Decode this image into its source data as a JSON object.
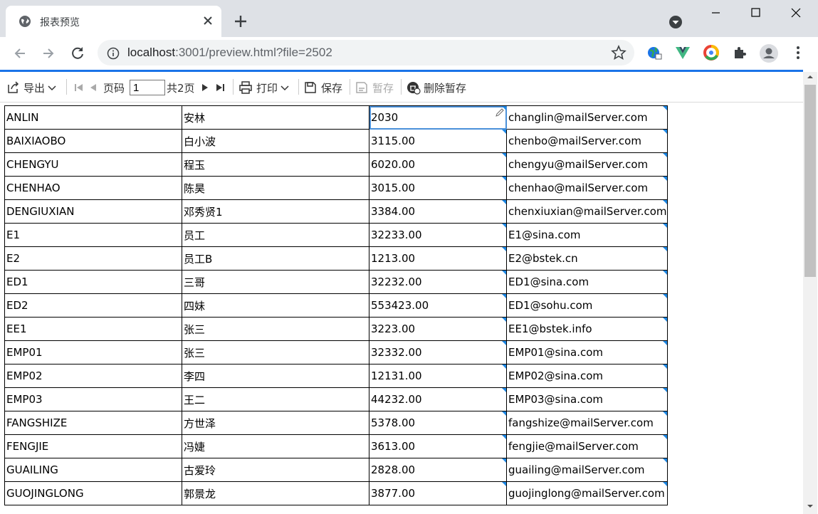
{
  "browser": {
    "tab_title": "报表预览",
    "url_host": "localhost",
    "url_rest": ":3001/preview.html?file=2502"
  },
  "toolbar": {
    "export": "导出",
    "page_label": "页码",
    "page_value": "1",
    "page_total": "共2页",
    "print": "打印",
    "save": "保存",
    "temp_save": "暂存",
    "delete_temp": "删除暂存"
  },
  "table": {
    "rows": [
      [
        "ANLIN",
        "安林",
        "2030",
        "changlin@mailServer.com"
      ],
      [
        "BAIXIAOBO",
        "白小波",
        "3115.00",
        "chenbo@mailServer.com"
      ],
      [
        "CHENGYU",
        "程玉",
        "6020.00",
        "chengyu@mailServer.com"
      ],
      [
        "CHENHAO",
        "陈昊",
        "3015.00",
        "chenhao@mailServer.com"
      ],
      [
        "DENGIUXIAN",
        "邓秀贤1",
        "3384.00",
        "chenxiuxian@mailServer.com"
      ],
      [
        "E1",
        "员工",
        "32233.00",
        "E1@sina.com"
      ],
      [
        "E2",
        "员工B",
        "1213.00",
        "E2@bstek.cn"
      ],
      [
        "ED1",
        "三哥",
        "32232.00",
        "ED1@sina.com"
      ],
      [
        "ED2",
        "四妹",
        "553423.00",
        "ED1@sohu.com"
      ],
      [
        "EE1",
        "张三",
        "3223.00",
        "EE1@bstek.info"
      ],
      [
        "EMP01",
        "张三",
        "32332.00",
        "EMP01@sina.com"
      ],
      [
        "EMP02",
        "李四",
        "12131.00",
        "EMP02@sina.com"
      ],
      [
        "EMP03",
        "王二",
        "44232.00",
        "EMP03@sina.com"
      ],
      [
        "FANGSHIZE",
        "方世泽",
        "5378.00",
        "fangshize@mailServer.com"
      ],
      [
        "FENGJIE",
        "冯婕",
        "3613.00",
        "fengjie@mailServer.com"
      ],
      [
        "GUAILING",
        "古爱玲",
        "2828.00",
        "guailing@mailServer.com"
      ],
      [
        "GUOJINGLONG",
        "郭景龙",
        "3877.00",
        "guojinglong@mailServer.com"
      ]
    ]
  },
  "colors": {
    "accent": "#1a73e8",
    "cell_marker": "#1e88e5",
    "selection": "#4a90d9"
  }
}
